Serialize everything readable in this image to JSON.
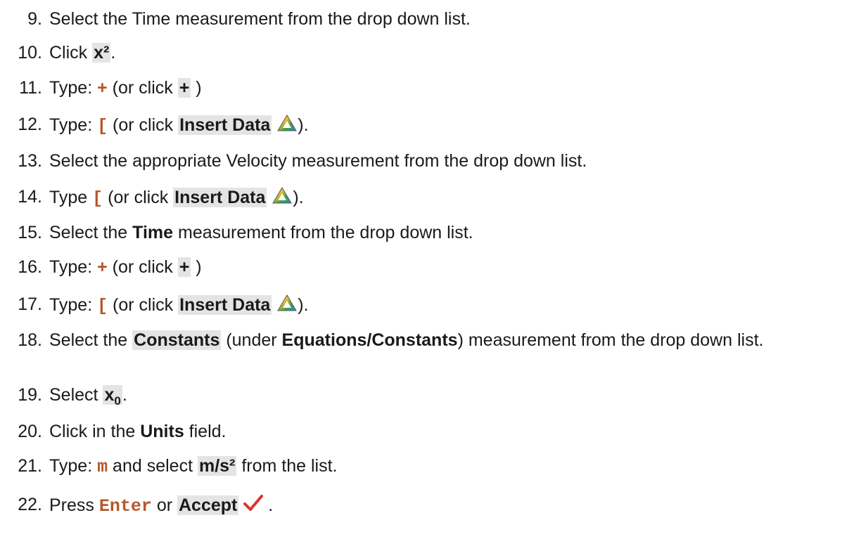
{
  "steps": [
    {
      "num": "9.",
      "text": "Select the Time measurement from the drop down list."
    },
    {
      "num": "10.",
      "pre": "Click ",
      "ui": "x²",
      "post": "."
    },
    {
      "num": "11.",
      "pre": "Type: ",
      "code": "+",
      "mid": " (or click ",
      "ui": "+",
      "post": " )"
    },
    {
      "num": "12.",
      "pre": "Type: ",
      "code": "[",
      "mid": " (or click ",
      "ui": "Insert Data",
      "post": ")."
    },
    {
      "num": "13.",
      "text": "Select the appropriate Velocity measurement from the drop down list."
    },
    {
      "num": "14.",
      "pre": "Type ",
      "code": "[",
      "mid": " (or click ",
      "ui": "Insert Data",
      "post": ")."
    },
    {
      "num": "15.",
      "pre": "Select the ",
      "bold": "Time",
      "post": " measurement from the drop down list."
    },
    {
      "num": "16.",
      "pre": "Type: ",
      "code": "+",
      "mid": " (or click ",
      "ui": "+",
      "post": " )"
    },
    {
      "num": "17.",
      "pre": "Type: ",
      "code": "[",
      "mid": " (or click ",
      "ui": "Insert Data",
      "post": ")."
    },
    {
      "num": "18.",
      "pre": "Select the ",
      "ui": "Constants",
      "mid": " (under ",
      "bold": "Equations/Constants",
      "post": ") measurement from the drop down list."
    },
    {
      "num": "19.",
      "pre": "Select ",
      "ui": "x",
      "sub": "0",
      "post": "."
    },
    {
      "num": "20.",
      "pre": "Click in the ",
      "bold": "Units",
      "post": " field."
    },
    {
      "num": "21.",
      "pre": "Type: ",
      "code": "m",
      "mid": " and select ",
      "ui": "m/s²",
      "post": " from the list."
    },
    {
      "num": "22.",
      "pre": "Press ",
      "code": "Enter",
      "mid": " or ",
      "ui": "Accept",
      "post": " ."
    }
  ],
  "icons": {
    "insert_data": "insert-data-icon",
    "accept": "checkmark-icon"
  },
  "colors": {
    "code": "#b5582b",
    "ui_highlight": "#e4e4e4",
    "checkmark": "#d9342b"
  }
}
